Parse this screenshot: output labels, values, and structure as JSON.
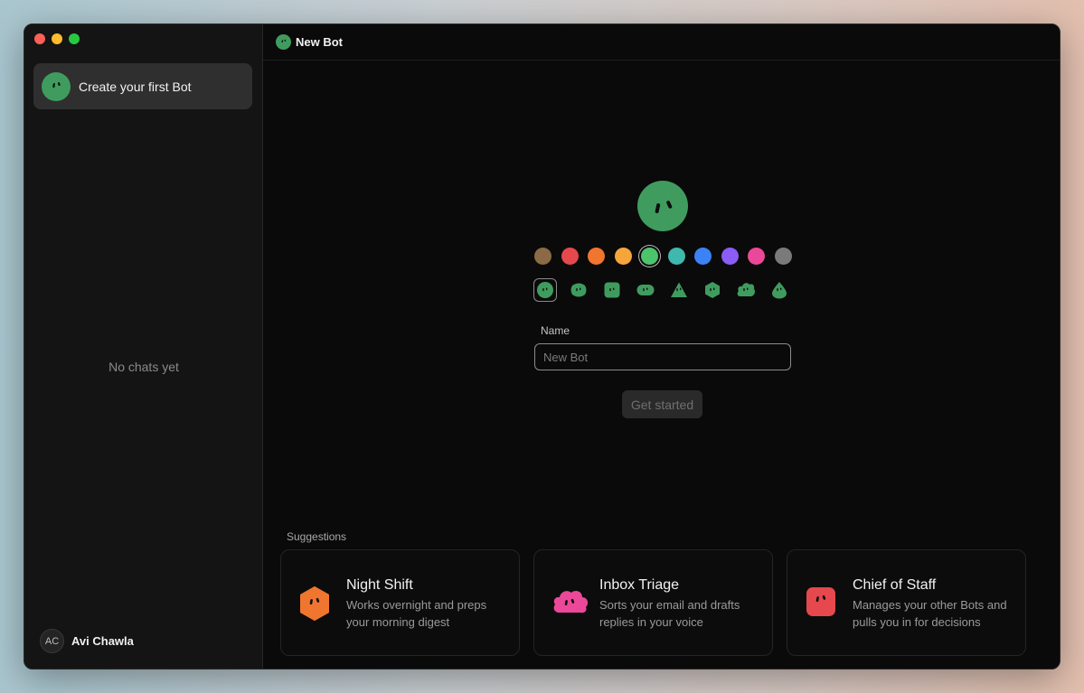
{
  "window": {
    "traffic_lights": [
      "close",
      "minimize",
      "zoom"
    ]
  },
  "sidebar": {
    "first_bot_label": "Create your first Bot",
    "empty_text": "No chats yet",
    "user": {
      "initials": "AC",
      "name": "Avi Chawla"
    }
  },
  "header": {
    "title": "New Bot",
    "icon": "bot-face-icon"
  },
  "editor": {
    "avatar_color": "#3f9c5e",
    "colors": [
      "#8b6a45",
      "#e5484d",
      "#f0752e",
      "#f5a53a",
      "#4cc46b",
      "#3fb8ad",
      "#3b82f6",
      "#8b5cf6",
      "#ec4899",
      "#7a7a7a"
    ],
    "selected_color_index": 4,
    "shapes": [
      "circle",
      "blob",
      "square",
      "pill",
      "triangle",
      "hexagon",
      "cloud",
      "drop"
    ],
    "selected_shape_index": 0,
    "name_label": "Name",
    "name_placeholder": "New Bot",
    "name_value": "",
    "submit_label": "Get started"
  },
  "suggestions": {
    "label": "Suggestions",
    "items": [
      {
        "title": "Night Shift",
        "description": "Works overnight and preps your morning digest",
        "icon": "hexagon-bot-icon",
        "color": "#f0752e"
      },
      {
        "title": "Inbox Triage",
        "description": "Sorts your email and drafts replies in your voice",
        "icon": "cloud-bot-icon",
        "color": "#ec4899"
      },
      {
        "title": "Chief of Staff",
        "description": "Manages your other Bots and pulls you in for decisions",
        "icon": "square-bot-icon",
        "color": "#e5484d"
      }
    ]
  }
}
